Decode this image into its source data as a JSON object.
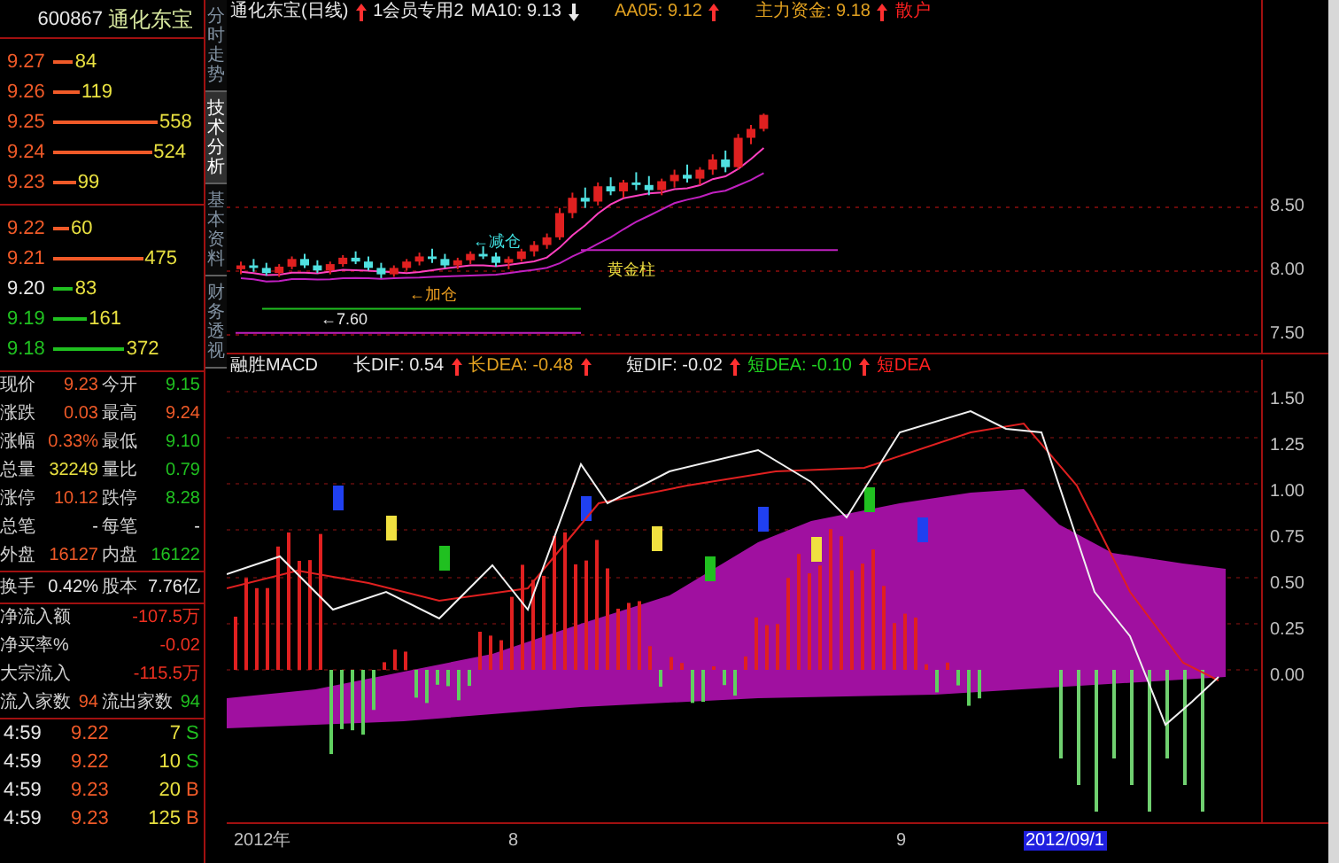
{
  "stock": {
    "code": "600867",
    "name": "通化东宝"
  },
  "asks": [
    {
      "price": {
        "text": "9.27",
        "color": "#f05a28"
      },
      "volume": "84",
      "bar": {
        "color": "#f05a28"
      }
    },
    {
      "price": {
        "text": "9.26",
        "color": "#f05a28"
      },
      "volume": "119",
      "bar": {
        "color": "#f05a28"
      }
    },
    {
      "price": {
        "text": "9.25",
        "color": "#f05a28"
      },
      "volume": "558",
      "bar": {
        "color": "#f05a28"
      }
    },
    {
      "price": {
        "text": "9.24",
        "color": "#f05a28"
      },
      "volume": "524",
      "bar": {
        "color": "#f05a28"
      }
    },
    {
      "price": {
        "text": "9.23",
        "color": "#f05a28"
      },
      "volume": "99",
      "bar": {
        "color": "#f05a28"
      }
    }
  ],
  "bids": [
    {
      "price": {
        "text": "9.22",
        "color": "#f05a28"
      },
      "volume": "60",
      "bar": {
        "color": "#f05a28"
      }
    },
    {
      "price": {
        "text": "9.21",
        "color": "#f05a28"
      },
      "volume": "475",
      "bar": {
        "color": "#f05a28"
      }
    },
    {
      "price": {
        "text": "9.20",
        "color": "#e8e8e8"
      },
      "volume": "83",
      "bar": {
        "color": "#20c020"
      }
    },
    {
      "price": {
        "text": "9.19",
        "color": "#20c020"
      },
      "volume": "161",
      "bar": {
        "color": "#20c020"
      }
    },
    {
      "price": {
        "text": "9.18",
        "color": "#20c020"
      },
      "volume": "372",
      "bar": {
        "color": "#20c020"
      }
    }
  ],
  "quote": [
    [
      {
        "label": "现价",
        "value": "9.23",
        "color": "#f05a28"
      },
      {
        "label": "今开",
        "value": "9.15",
        "color": "#20c020"
      }
    ],
    [
      {
        "label": "涨跌",
        "value": "0.03",
        "color": "#f05a28"
      },
      {
        "label": "最高",
        "value": "9.24",
        "color": "#f05a28"
      }
    ],
    [
      {
        "label": "涨幅",
        "value": "0.33%",
        "color": "#f05a28"
      },
      {
        "label": "最低",
        "value": "9.10",
        "color": "#20c020"
      }
    ],
    [
      {
        "label": "总量",
        "value": "32249",
        "color": "#e8e040"
      },
      {
        "label": "量比",
        "value": "0.79",
        "color": "#20c020"
      }
    ],
    [
      {
        "label": "涨停",
        "value": "10.12",
        "color": "#f05a28"
      },
      {
        "label": "跌停",
        "value": "8.28",
        "color": "#20c020"
      }
    ],
    [
      {
        "label": "总笔",
        "value": "-",
        "color": "#e8e8e8"
      },
      {
        "label": "每笔",
        "value": "-",
        "color": "#e8e8e8"
      }
    ],
    [
      {
        "label": "外盘",
        "value": "16127",
        "color": "#f05a28"
      },
      {
        "label": "内盘",
        "value": "16122",
        "color": "#20c020"
      }
    ]
  ],
  "turnover": [
    {
      "label": "换手",
      "value": "0.42%",
      "color": "#e8e8e8"
    },
    {
      "label": "股本",
      "value": "7.76亿",
      "color": "#e8e8e8"
    }
  ],
  "flows": [
    {
      "label": "净流入额",
      "value": "-107.5万"
    },
    {
      "label": "净买率%",
      "value": "-0.02"
    },
    {
      "label": "大宗流入",
      "value": "-115.5万"
    }
  ],
  "flow_counts": [
    {
      "label": "流入家数",
      "value": "94",
      "color": "#f05a28"
    },
    {
      "label": "流出家数",
      "value": "94",
      "color": "#20c020"
    }
  ],
  "trades": [
    {
      "time": "4:59",
      "price": "9.22",
      "volume": "7",
      "side": "S",
      "color": "#20c020"
    },
    {
      "time": "4:59",
      "price": "9.22",
      "volume": "10",
      "side": "S",
      "color": "#20c020"
    },
    {
      "time": "4:59",
      "price": "9.23",
      "volume": "20",
      "side": "B",
      "color": "#f05a28"
    },
    {
      "time": "4:59",
      "price": "9.23",
      "volume": "125",
      "side": "B",
      "color": "#f05a28"
    }
  ],
  "view_tabs": [
    {
      "label": "分时走势",
      "selected": false
    },
    {
      "label": "技术分析",
      "selected": true
    },
    {
      "label": "基本资料",
      "selected": false
    },
    {
      "label": "财务透视",
      "selected": false
    }
  ],
  "price_chart": {
    "header": [
      {
        "kind": "text",
        "text": "通化东宝(日线)",
        "color": "#e8e8e8"
      },
      {
        "kind": "up_arrow",
        "color": "#ff3030"
      },
      {
        "kind": "text",
        "text": "1会员专用2",
        "color": "#e8e8e8"
      },
      {
        "kind": "text",
        "text": "MA10: 9.13",
        "color": "#e8e8e8"
      },
      {
        "kind": "down_arrow",
        "color": "#e8e8e8"
      },
      {
        "kind": "gap"
      },
      {
        "kind": "text",
        "text": "AA05: 9.12",
        "color": "#e0a020"
      },
      {
        "kind": "up_arrow",
        "color": "#ff3030"
      },
      {
        "kind": "gap"
      },
      {
        "kind": "text",
        "text": "主力资金: 9.18",
        "color": "#e0a020"
      },
      {
        "kind": "up_arrow",
        "color": "#ff3030"
      },
      {
        "kind": "text",
        "text": "散户",
        "color": "#ff2020"
      }
    ],
    "annotations": [
      "←减仓",
      "黄金柱",
      "←加仓",
      "←7.60"
    ],
    "yticks": [
      "8.50",
      "8.00",
      "7.50"
    ]
  },
  "macd_chart": {
    "header": [
      {
        "kind": "text",
        "text": "融胜MACD",
        "color": "#e8e8e8"
      },
      {
        "kind": "gap"
      },
      {
        "kind": "text",
        "text": "长DIF: 0.54",
        "color": "#e8e8e8"
      },
      {
        "kind": "up_arrow",
        "color": "#ff3030"
      },
      {
        "kind": "text",
        "text": "长DEA: -0.48",
        "color": "#e0a020"
      },
      {
        "kind": "up_arrow",
        "color": "#ff3030"
      },
      {
        "kind": "gap"
      },
      {
        "kind": "text",
        "text": "短DIF: -0.02",
        "color": "#e8e8e8"
      },
      {
        "kind": "up_arrow",
        "color": "#ff3030"
      },
      {
        "kind": "text",
        "text": "短DEA: -0.10",
        "color": "#20d020"
      },
      {
        "kind": "up_arrow",
        "color": "#ff3030"
      },
      {
        "kind": "text",
        "text": "短DEA",
        "color": "#ff2020"
      }
    ],
    "yticks": [
      "1.50",
      "1.25",
      "1.00",
      "0.75",
      "0.50",
      "0.25",
      "0.00"
    ]
  },
  "date_axis": [
    {
      "label": "2012年",
      "selected": false
    },
    {
      "label": "8",
      "selected": false
    },
    {
      "label": "9",
      "selected": false
    },
    {
      "label": "2012/09/1",
      "selected": true
    }
  ]
}
